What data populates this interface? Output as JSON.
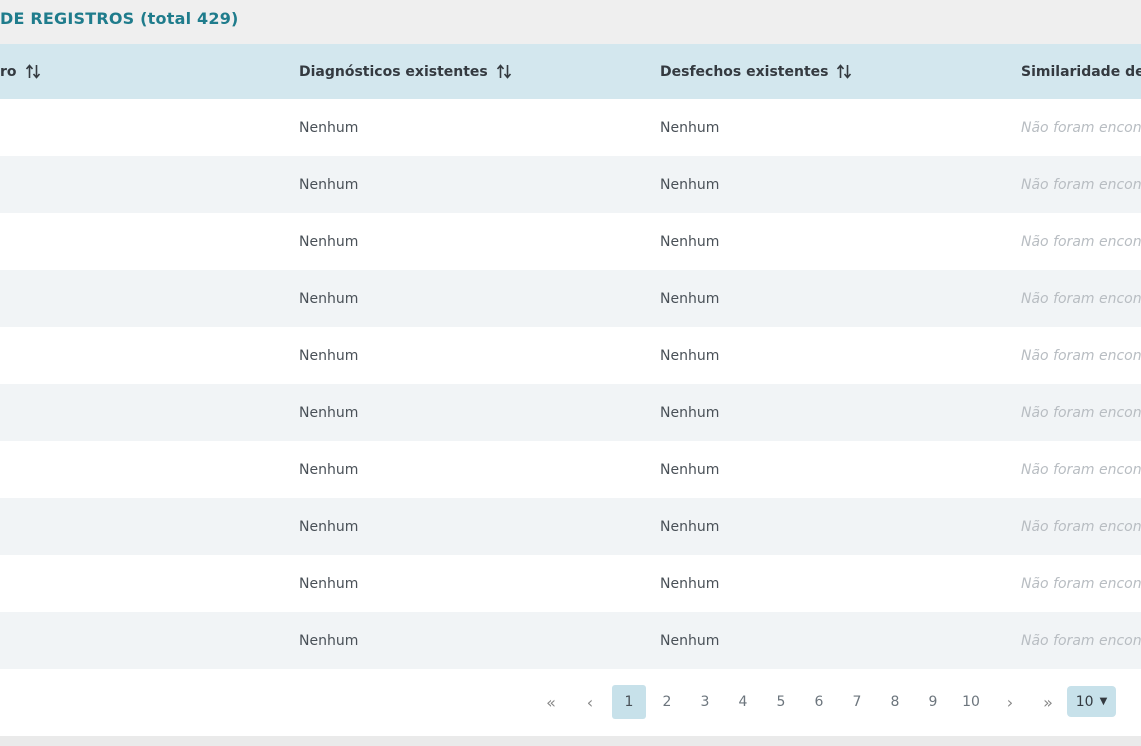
{
  "header": {
    "title": "DE REGISTROS (total 429)"
  },
  "table": {
    "columns": [
      {
        "label": "ro",
        "sortable": true
      },
      {
        "label": "Diagnósticos existentes",
        "sortable": true
      },
      {
        "label": "Desfechos existentes",
        "sortable": true
      },
      {
        "label": "Similaridade de r",
        "sortable": false
      }
    ],
    "rows": [
      {
        "col1": "",
        "diagnosticos": "Nenhum",
        "desfechos": "Nenhum",
        "similaridade": "Não foram encontr"
      },
      {
        "col1": "",
        "diagnosticos": "Nenhum",
        "desfechos": "Nenhum",
        "similaridade": "Não foram encontr"
      },
      {
        "col1": "",
        "diagnosticos": "Nenhum",
        "desfechos": "Nenhum",
        "similaridade": "Não foram encontr"
      },
      {
        "col1": "",
        "diagnosticos": "Nenhum",
        "desfechos": "Nenhum",
        "similaridade": "Não foram encontr"
      },
      {
        "col1": "",
        "diagnosticos": "Nenhum",
        "desfechos": "Nenhum",
        "similaridade": "Não foram encontr"
      },
      {
        "col1": "",
        "diagnosticos": "Nenhum",
        "desfechos": "Nenhum",
        "similaridade": "Não foram encontr"
      },
      {
        "col1": "",
        "diagnosticos": "Nenhum",
        "desfechos": "Nenhum",
        "similaridade": "Não foram encontr"
      },
      {
        "col1": "",
        "diagnosticos": "Nenhum",
        "desfechos": "Nenhum",
        "similaridade": "Não foram encontr"
      },
      {
        "col1": "",
        "diagnosticos": "Nenhum",
        "desfechos": "Nenhum",
        "similaridade": "Não foram encontr"
      },
      {
        "col1": "",
        "diagnosticos": "Nenhum",
        "desfechos": "Nenhum",
        "similaridade": "Não foram encontr"
      }
    ]
  },
  "paginator": {
    "first": "«",
    "prev": "‹",
    "pages": [
      "1",
      "2",
      "3",
      "4",
      "5",
      "6",
      "7",
      "8",
      "9",
      "10"
    ],
    "current_page": "1",
    "next": "›",
    "last": "»",
    "rows_per_page": "10"
  },
  "colors": {
    "accent": "#1f7c8c",
    "header_bg": "#d3e7ee",
    "active_page": "#c7e1ea"
  }
}
